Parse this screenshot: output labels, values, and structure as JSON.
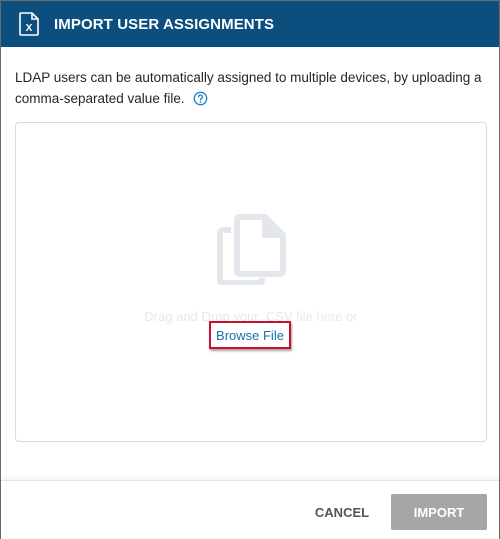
{
  "dialog": {
    "title": "IMPORT USER ASSIGNMENTS",
    "title_icon": "excel-file-icon",
    "description": "LDAP users can be automatically assigned to multiple devices, by uploading a comma-separated value file.",
    "help_icon": "question-circle-icon"
  },
  "dropzone": {
    "icon": "files-copy-icon",
    "drag_text": "Drag and Drop your .CSV file here or",
    "browse_label": "Browse File"
  },
  "footer": {
    "cancel_label": "CANCEL",
    "import_label": "IMPORT"
  },
  "colors": {
    "header_bg": "#0c4e7e",
    "link": "#1a6fa8",
    "highlight_border": "#c8102e",
    "import_disabled_bg": "#a6a6a6"
  }
}
